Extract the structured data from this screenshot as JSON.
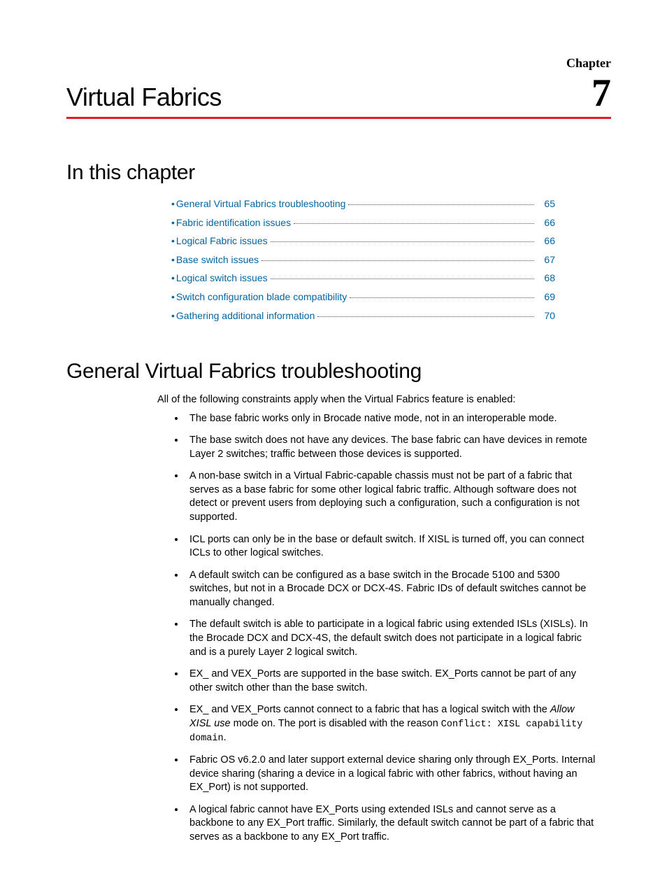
{
  "header": {
    "chapter_label": "Chapter",
    "title": "Virtual Fabrics",
    "chapter_number": "7"
  },
  "sections": {
    "toc_heading": "In this chapter",
    "main_heading": "General Virtual Fabrics troubleshooting"
  },
  "toc": [
    {
      "label": "General Virtual Fabrics troubleshooting",
      "page": "65"
    },
    {
      "label": "Fabric identification issues",
      "page": "66"
    },
    {
      "label": "Logical Fabric issues",
      "page": "66"
    },
    {
      "label": "Base switch issues",
      "page": "67"
    },
    {
      "label": "Logical switch issues",
      "page": "68"
    },
    {
      "label": "Switch configuration blade compatibility",
      "page": "69"
    },
    {
      "label": "Gathering additional information",
      "page": "70"
    }
  ],
  "intro": "All of the following constraints apply when the Virtual Fabrics feature is enabled:",
  "bullets": {
    "b0": "The base fabric works only in Brocade native mode, not in an interoperable mode.",
    "b1": "The base switch does not have any devices. The base fabric can have devices in remote Layer 2 switches; traffic between those devices is supported.",
    "b2": "A non-base switch in a Virtual Fabric-capable chassis must not be part of a fabric that serves as a base fabric for some other logical fabric traffic. Although software does not detect or prevent users from deploying such a configuration, such a configuration is not supported.",
    "b3": "ICL ports can only be in the base or default switch. If XISL is turned off, you can connect ICLs to other logical switches.",
    "b4": "A default switch can be configured as a base switch in the Brocade 5100 and 5300 switches, but not in a Brocade DCX or DCX-4S. Fabric IDs of default switches cannot be manually changed.",
    "b5": "The default switch is able to participate in a logical fabric using extended ISLs (XISLs). In the Brocade DCX and DCX-4S, the default switch does not participate in a logical fabric and is a purely Layer 2 logical switch.",
    "b6": "EX_ and VEX_Ports are supported in the base switch. EX_Ports cannot be part of any other switch other than the base switch.",
    "b7_pre": "EX_ and VEX_Ports cannot connect to a fabric that has a logical switch with the ",
    "b7_ital": "Allow XISL use",
    "b7_mid": " mode on. The port is disabled with the reason ",
    "b7_mono": "Conflict: XISL capability domain",
    "b7_post": ".",
    "b8": "Fabric OS v6.2.0 and later support external device sharing only through EX_Ports. Internal device sharing (sharing a device in a logical fabric with other fabrics, without having an EX_Port) is not supported.",
    "b9": "A logical fabric cannot have EX_Ports using extended ISLs and cannot serve as a backbone to any EX_Port traffic. Similarly, the default switch cannot be part of a fabric that serves as a backbone to any EX_Port traffic."
  }
}
